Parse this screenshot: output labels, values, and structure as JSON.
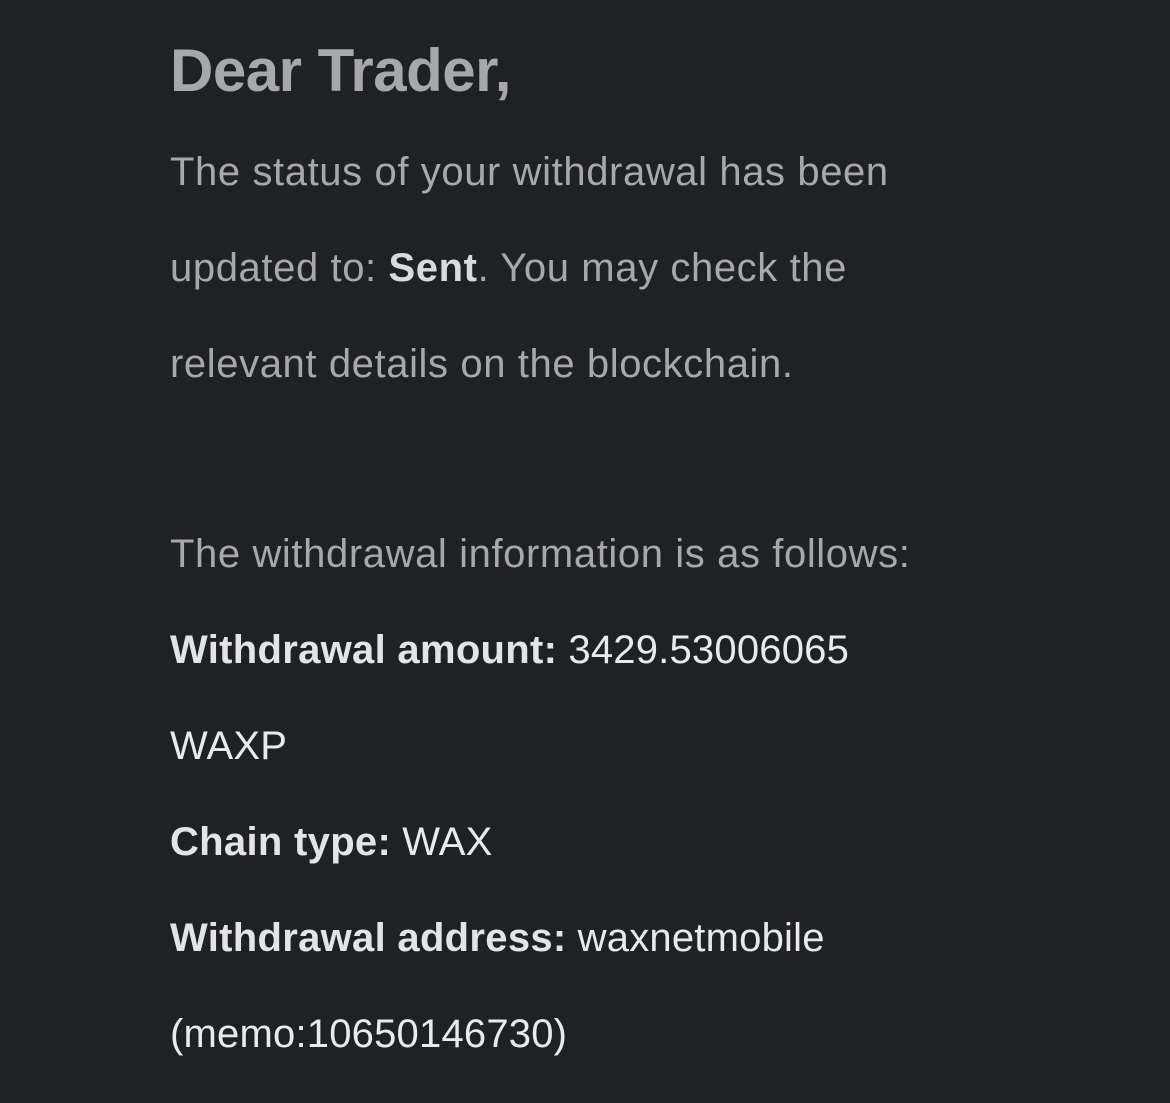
{
  "greeting": "Dear Trader,",
  "status_message": {
    "line1": "The status of your withdrawal has been",
    "line2_before": "updated to: ",
    "status": "Sent",
    "line2_after": ". You may check the",
    "line3": "relevant details on the blockchain."
  },
  "info_intro": "The withdrawal information is as follows:",
  "withdrawal": {
    "amount_label": "Withdrawal amount:",
    "amount_value": "3429.53006065",
    "amount_unit": "WAXP",
    "chain_label": "Chain type:",
    "chain_value": "WAX",
    "address_label": "Withdrawal address:",
    "address_value": "waxnetmobile",
    "memo": "(memo:10650146730)"
  },
  "colors": {
    "background": "#202125",
    "muted_text": "#a7a8ac",
    "bright_text": "#e9eaec"
  }
}
